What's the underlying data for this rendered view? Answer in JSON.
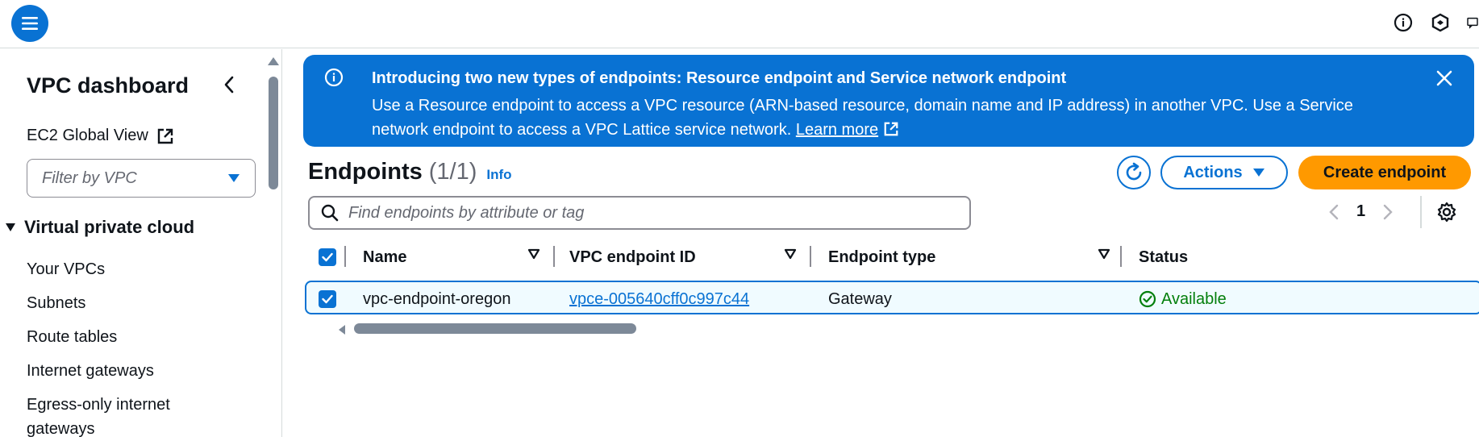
{
  "topbar": {
    "icons": [
      "menu-icon",
      "info-circle-icon",
      "shield-hex-icon",
      "feedback-icon"
    ]
  },
  "sidebar": {
    "title": "VPC dashboard",
    "ec2_link": "EC2 Global View",
    "filter_placeholder": "Filter by VPC",
    "section": "Virtual private cloud",
    "items": [
      {
        "label": "Your VPCs"
      },
      {
        "label": "Subnets"
      },
      {
        "label": "Route tables"
      },
      {
        "label": "Internet gateways"
      },
      {
        "label": "Egress-only internet gateways"
      }
    ]
  },
  "flash": {
    "title": "Introducing two new types of endpoints: Resource endpoint and Service network endpoint",
    "body": "Use a Resource endpoint to access a VPC resource (ARN-based resource, domain name and IP address) in another VPC. Use a Service network endpoint to access a VPC Lattice service network.",
    "link": "Learn more",
    "color": "#0972d3"
  },
  "header": {
    "title": "Endpoints",
    "count": "(1/1)",
    "info": "Info",
    "actions_label": "Actions",
    "create_label": "Create endpoint"
  },
  "search": {
    "placeholder": "Find endpoints by attribute or tag"
  },
  "pagination": {
    "current_page": "1"
  },
  "table": {
    "columns": [
      "Name",
      "VPC endpoint ID",
      "Endpoint type",
      "Status"
    ],
    "rows": [
      {
        "name": "vpc-endpoint-oregon",
        "id": "vpce-005640cff0c997c44",
        "type": "Gateway",
        "status": "Available"
      }
    ]
  },
  "colors": {
    "primary": "#0972d3",
    "create_button": "#ff9900",
    "status_ok": "#037f0c"
  }
}
